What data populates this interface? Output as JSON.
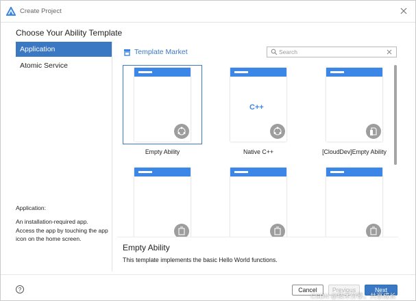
{
  "window": {
    "title": "Create Project"
  },
  "heading": "Choose Your Ability Template",
  "sidebar": {
    "items": [
      {
        "label": "Application",
        "active": true
      },
      {
        "label": "Atomic Service",
        "active": false
      }
    ],
    "description_title": "Application:",
    "description": "An installation-required app. Access the app by touching the app icon on the home screen."
  },
  "market": {
    "label": "Template Market"
  },
  "search": {
    "placeholder": "Search",
    "value": ""
  },
  "templates": [
    {
      "label": "Empty Ability",
      "selected": true,
      "badge_icon": "ability-icon"
    },
    {
      "label": "Native C++",
      "selected": false,
      "badge_icon": "ability-icon",
      "center_mark": "C++"
    },
    {
      "label": "[CloudDev]Empty Ability",
      "selected": false,
      "badge_icon": "cloud-document-icon"
    },
    {
      "label": "",
      "selected": false,
      "badge_icon": "template-icon"
    },
    {
      "label": "",
      "selected": false,
      "badge_icon": "template-icon"
    },
    {
      "label": "",
      "selected": false,
      "badge_icon": "template-icon"
    }
  ],
  "selected_template": {
    "name": "Empty Ability",
    "description": "This template implements the basic Hello World functions."
  },
  "footer": {
    "cancel_label": "Cancel",
    "previous_label": "Previous",
    "next_label": "Next",
    "help_glyph": "?"
  },
  "watermark": "CSDN @技术分享，共享成长",
  "colors": {
    "accent": "#3a78c3",
    "phone_bar": "#3b86e6",
    "badge": "#9d9d9d"
  }
}
